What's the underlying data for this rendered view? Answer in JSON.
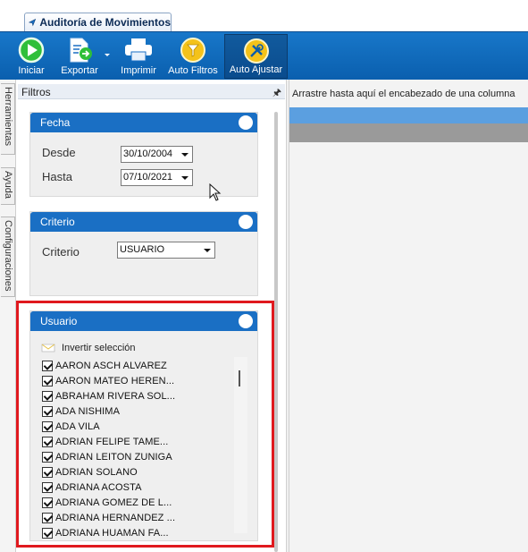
{
  "window": {
    "tab_title": "Auditoría de Movimientos"
  },
  "toolbar": {
    "buttons": [
      {
        "label": "Iniciar",
        "icon": "play-icon"
      },
      {
        "label": "Exportar",
        "icon": "export-icon"
      },
      {
        "label": "Imprimir",
        "icon": "printer-icon"
      },
      {
        "label": "Auto Filtros",
        "icon": "auto-filter-icon"
      },
      {
        "label": "Auto Ajustar",
        "icon": "auto-adjust-icon"
      }
    ]
  },
  "side_tabs": [
    "Herramientas",
    "Ayuda",
    "Configuraciones"
  ],
  "filters": {
    "title": "Filtros",
    "pin": "📌",
    "fecha": {
      "title": "Fecha",
      "desde_label": "Desde",
      "desde_value": "30/10/2004",
      "hasta_label": "Hasta",
      "hasta_value": "07/10/2021"
    },
    "criterio": {
      "title": "Criterio",
      "label": "Criterio",
      "value": "USUARIO"
    },
    "usuario": {
      "title": "Usuario",
      "invert_label": "Invertir selección",
      "users": [
        "AARON ASCH ALVAREZ",
        "AARON MATEO HEREN...",
        "ABRAHAM RIVERA SOL...",
        "ADA NISHIMA",
        "ADA VILA",
        "ADRIAN FELIPE TAME...",
        "ADRIAN LEITON ZUNIGA",
        "ADRIAN SOLANO",
        "ADRIANA ACOSTA",
        "ADRIANA GOMEZ DE L...",
        "ADRIANA HERNANDEZ ...",
        "ADRIANA HUAMAN FA..."
      ]
    }
  },
  "grid": {
    "group_by_hint": "Arrastre hasta aquí el encabezado de una columna"
  },
  "colors": {
    "ribbon": "#0a5fae",
    "group_header": "#1a6fc4",
    "highlight": "#e0191e"
  }
}
